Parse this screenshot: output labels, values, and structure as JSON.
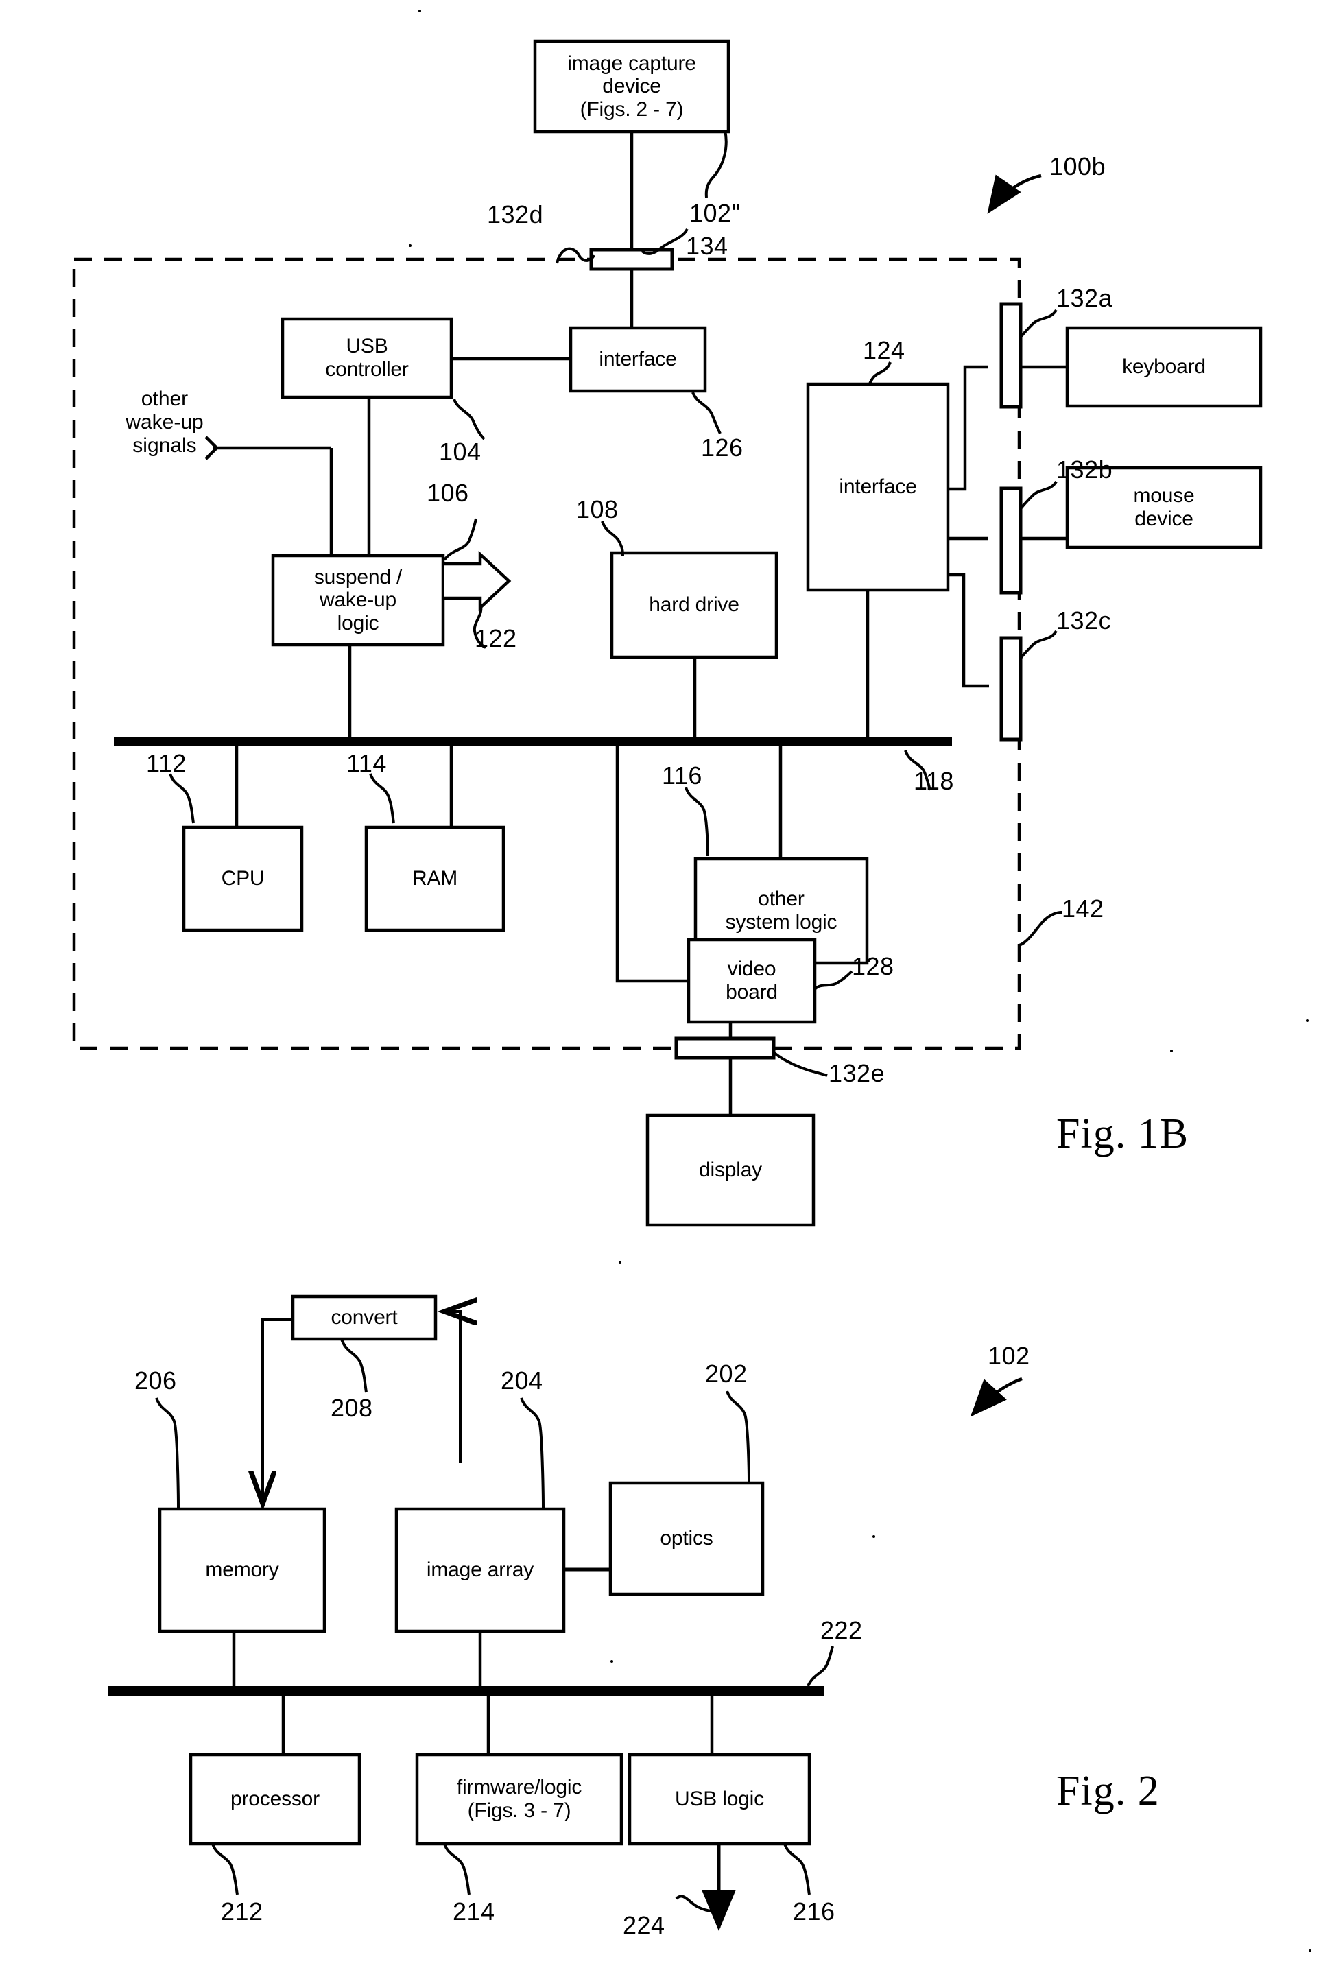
{
  "document": {
    "type": "patent-figure-sheet",
    "figures": [
      {
        "caption": "Fig. 1B"
      },
      {
        "caption": "Fig. 2"
      }
    ]
  },
  "fig1b": {
    "caption": "Fig. 1B",
    "system_ref": "100b",
    "boundary_ref": "142",
    "boxes": {
      "image_capture_device": "image capture\ndevice\n(Figs. 2 - 7)",
      "usb_controller": "USB\ncontroller",
      "interface_top": "interface",
      "suspend_wakeup_logic": "suspend /\nwake-up\nlogic",
      "hard_drive": "hard drive",
      "interface_right": "interface",
      "keyboard": "keyboard",
      "mouse_device": "mouse\ndevice",
      "cpu": "CPU",
      "ram": "RAM",
      "other_system_logic": "other\nsystem logic",
      "video_board": "video\nboard",
      "display": "display"
    },
    "free_text": {
      "other_wakeup_signals": "other\nwake-up\nsignals"
    },
    "refs": {
      "image_capture_device": "102\"",
      "connector_top": "132d",
      "hub_134": "134",
      "usb_controller": "104",
      "suspend_wakeup_logic": "106",
      "suspend_output": "122",
      "interface_top": "126",
      "hard_drive": "108",
      "interface_right": "124",
      "connector_keyboard": "132a",
      "connector_mouse": "132b",
      "connector_third": "132c",
      "cpu": "112",
      "ram": "114",
      "other_system_logic": "116",
      "bus": "118",
      "video_board": "128",
      "connector_display": "132e",
      "boundary": "142",
      "system": "100b"
    }
  },
  "fig2": {
    "caption": "Fig. 2",
    "device_ref": "102",
    "boxes": {
      "convert": "convert",
      "memory": "memory",
      "image_array": "image array",
      "optics": "optics",
      "processor": "processor",
      "firmware_logic": "firmware/logic\n(Figs. 3 - 7)",
      "usb_logic": "USB logic"
    },
    "refs": {
      "memory": "206",
      "convert": "208",
      "image_array": "204",
      "optics": "202",
      "device": "102",
      "bus": "222",
      "processor": "212",
      "firmware_logic": "214",
      "usb_output": "224",
      "usb_logic": "216"
    }
  }
}
